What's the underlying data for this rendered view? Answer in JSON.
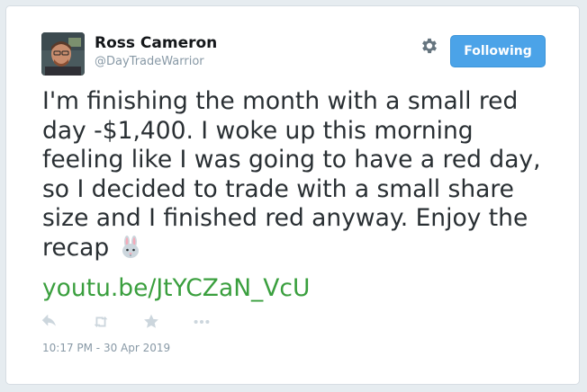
{
  "user": {
    "display_name": "Ross Cameron",
    "handle": "@DayTradeWarrior"
  },
  "follow_button": {
    "label": "Following"
  },
  "tweet": {
    "text": "I'm finishing the month with a small red day -$1,400. I woke up this morning feeling like I was going to have a red day, so I decided to trade with a small share size and I finished red anyway. Enjoy the recap",
    "emoji": "rabbit-face",
    "link": "youtu.be/JtYCZaN_VcU",
    "timestamp": "10:17 PM - 30 Apr 2019"
  },
  "actions": [
    "reply-icon",
    "retweet-icon",
    "like-icon",
    "more-icon"
  ],
  "colors": {
    "follow_button": "#4ba3e8",
    "link": "#3a9f3e",
    "text": "#292f33",
    "muted": "#8899a6"
  }
}
